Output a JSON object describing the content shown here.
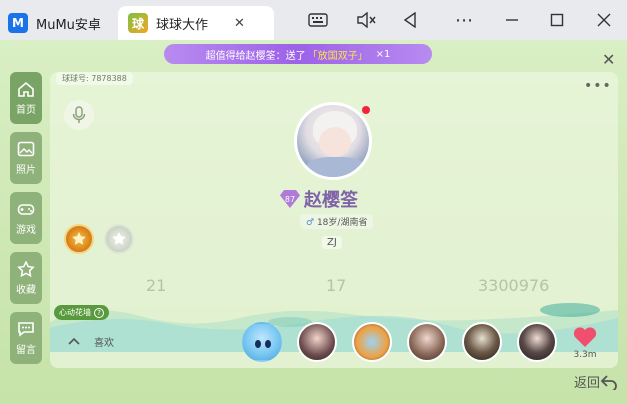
{
  "browser": {
    "tabs": [
      {
        "label": "MuMu安卓",
        "icon": "mumu-icon",
        "icon_text": "M"
      },
      {
        "label": "球球大作",
        "icon": "game-icon",
        "icon_text": "球"
      }
    ],
    "controls": [
      "keyboard-icon",
      "mute-icon",
      "back-icon",
      "more-icon",
      "minimize-icon",
      "maximize-icon",
      "close-icon"
    ]
  },
  "banner": {
    "text": "超值得给赵樱筌：送了",
    "highlight": "「放国双子」",
    "count": "×1"
  },
  "sidebar": {
    "items": [
      {
        "label": "首页",
        "icon": "home-icon"
      },
      {
        "label": "照片",
        "icon": "photo-icon"
      },
      {
        "label": "游戏",
        "icon": "gamepad-icon"
      },
      {
        "label": "收藏",
        "icon": "collect-icon"
      },
      {
        "label": "留言",
        "icon": "message-icon"
      }
    ]
  },
  "profile": {
    "id_label": "球球号: 7878388",
    "level": "87",
    "name": "赵樱筌",
    "gender_symbol": "♂",
    "details": "18岁/湖南省",
    "tag": "ZJ"
  },
  "stats": {
    "value1": "21",
    "value2": "17",
    "value3": "3300976"
  },
  "garden": {
    "label": "心动花墙",
    "help": "?"
  },
  "likes": {
    "label": "喜欢",
    "count": "3.3m"
  },
  "footer": {
    "back_label": "返回"
  },
  "colors": {
    "accent_purple": "#9c62e8",
    "sidebar_green": "#8fb27a",
    "name_purple": "#7f63a8",
    "heart_red": "#f0506e"
  }
}
